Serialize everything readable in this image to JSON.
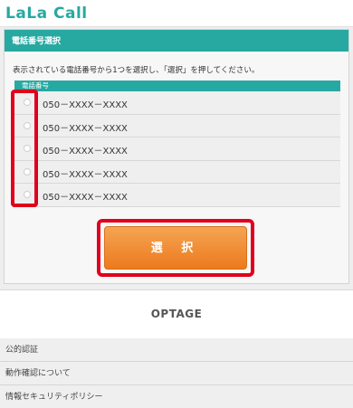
{
  "app": {
    "logo": "LaLa Call"
  },
  "panel": {
    "title": "電話番号選択",
    "instruction": "表示されている電話番号から1つを選択し、「選択」を押してください。",
    "table_header": "電話番号",
    "numbers": [
      "050－XXXX－XXXX",
      "050－XXXX－XXXX",
      "050－XXXX－XXXX",
      "050－XXXX－XXXX",
      "050－XXXX－XXXX"
    ],
    "select_button": "選 択"
  },
  "footer": {
    "brand": "OPTAGE",
    "links": [
      "公的認証",
      "動作確認について",
      "情報セキュリティポリシー"
    ]
  },
  "colors": {
    "accent": "#27a9a2",
    "button": "#ec7a1d",
    "highlight": "#e0001b"
  }
}
